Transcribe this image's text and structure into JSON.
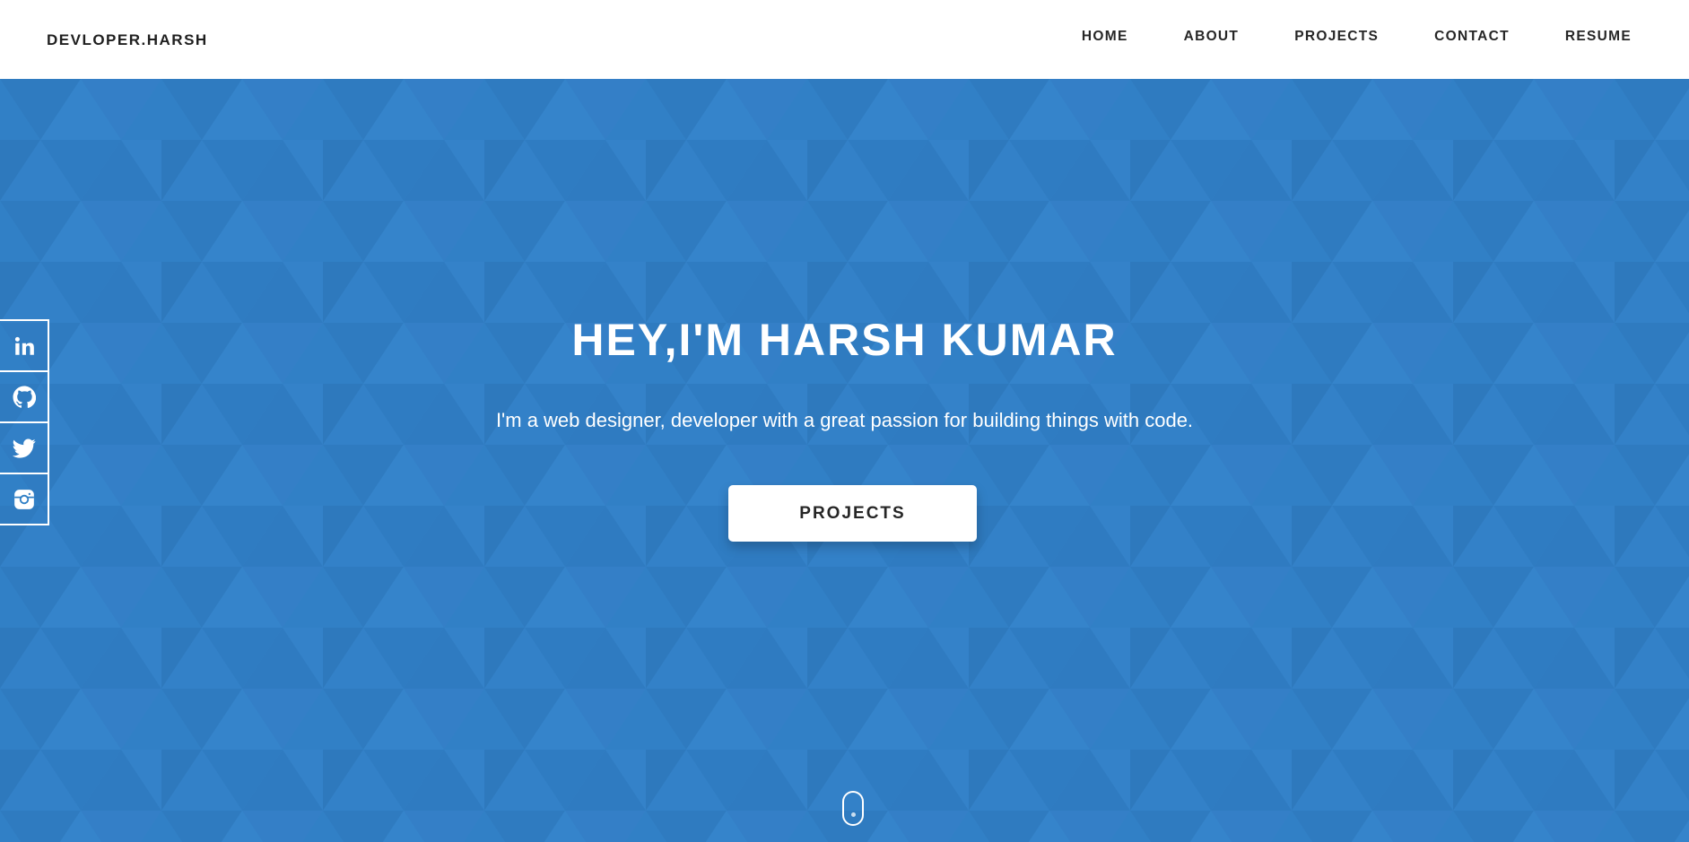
{
  "nav": {
    "brand": "DEVLOPER.HARSH",
    "links": [
      {
        "label": "HOME"
      },
      {
        "label": "ABOUT"
      },
      {
        "label": "PROJECTS"
      },
      {
        "label": "CONTACT"
      },
      {
        "label": "RESUME"
      }
    ]
  },
  "hero": {
    "title": "HEY,I'M HARSH KUMAR",
    "subtitle": "I'm a web designer, developer with a great passion for building things with code.",
    "button_label": "PROJECTS",
    "background_color": "#3180c6"
  },
  "social": {
    "icons": [
      "linkedin-icon",
      "github-icon",
      "twitter-icon",
      "instagram-icon"
    ]
  },
  "colors": {
    "accent": "#3180c6",
    "nav_text": "#262626",
    "white": "#ffffff"
  }
}
